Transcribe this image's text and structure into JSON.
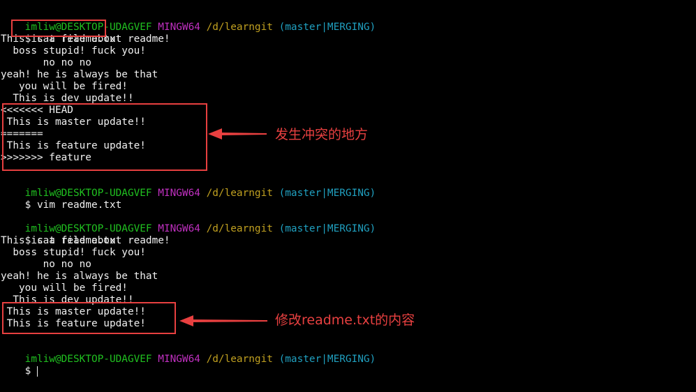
{
  "prompt": {
    "user_host": "imliw@DESKTOP-UDAGVEF",
    "system": "MINGW64",
    "path": "/d/learngit",
    "branch": "(master|MERGING)",
    "symbol": "$"
  },
  "block1": {
    "command": "cat readme.txt",
    "output": [
      "This is a file about readme!",
      "  boss stupid! fuck you!",
      "       no no no",
      "yeah! he is always be that",
      "   you will be fired!",
      "  This is dev update!!"
    ],
    "conflict": [
      "<<<<<<< HEAD",
      " This is master update!!",
      "=======",
      " This is feature update!",
      ">>>>>>> feature"
    ]
  },
  "block2": {
    "command": "vim readme.txt"
  },
  "block3": {
    "command": "cat readme.txt",
    "output": [
      "This is a file about readme!",
      "  boss stupid! fuck you!",
      "       no no no",
      "yeah! he is always be that",
      "   you will be fired!",
      "  This is dev update!!"
    ],
    "resolved": [
      " This is master update!!",
      " This is feature update!"
    ]
  },
  "annotations": {
    "conflict_label": "发生冲突的地方",
    "edit_label": "修改readme.txt的内容"
  },
  "colors": {
    "background": "#000000",
    "text": "#f0f0f0",
    "user_host": "#20c020",
    "system": "#c030c0",
    "path": "#c0a020",
    "branch": "#20a0c0",
    "annotation": "#e84040"
  }
}
